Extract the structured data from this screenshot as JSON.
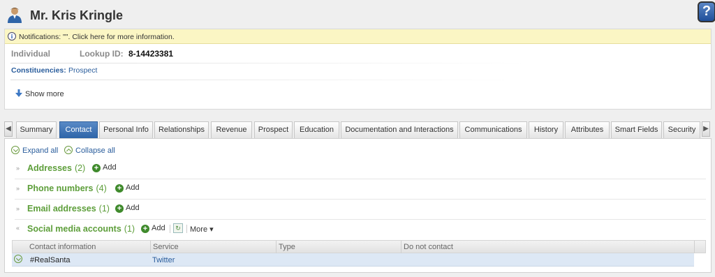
{
  "header": {
    "name": "Mr. Kris Kringle",
    "help_label": "?"
  },
  "notification": {
    "text": "Notifications: \"\". Click here for more information."
  },
  "record": {
    "type": "Individual",
    "lookup_label": "Lookup ID:",
    "lookup_value": "8-14423381",
    "constituencies_label": "Constituencies:",
    "constituencies_value": "Prospect",
    "show_more": "Show more"
  },
  "tabs": [
    {
      "label": "Summary"
    },
    {
      "label": "Contact"
    },
    {
      "label": "Personal Info"
    },
    {
      "label": "Relationships"
    },
    {
      "label": "Revenue"
    },
    {
      "label": "Prospect"
    },
    {
      "label": "Education"
    },
    {
      "label": "Documentation and Interactions"
    },
    {
      "label": "Communications"
    },
    {
      "label": "History"
    },
    {
      "label": "Attributes"
    },
    {
      "label": "Smart Fields"
    },
    {
      "label": "Security"
    }
  ],
  "active_tab": "Contact",
  "toolbar": {
    "expand_all": "Expand all",
    "collapse_all": "Collapse all"
  },
  "sections": [
    {
      "title": "Addresses",
      "count": "(2)",
      "add": "Add"
    },
    {
      "title": "Phone numbers",
      "count": "(4)",
      "add": "Add"
    },
    {
      "title": "Email addresses",
      "count": "(1)",
      "add": "Add"
    },
    {
      "title": "Social media accounts",
      "count": "(1)",
      "add": "Add",
      "more": "More"
    }
  ],
  "grid": {
    "columns": [
      "Contact information",
      "Service",
      "Type",
      "Do not contact"
    ],
    "rows": [
      {
        "contact": "#RealSanta",
        "service": "Twitter",
        "type": "",
        "do_not_contact": ""
      }
    ]
  },
  "colors": {
    "accent_green": "#5d9e3a",
    "link_blue": "#2a5d9c",
    "active_tab": "#3a72b5",
    "notification_bg": "#fbf6c4"
  }
}
